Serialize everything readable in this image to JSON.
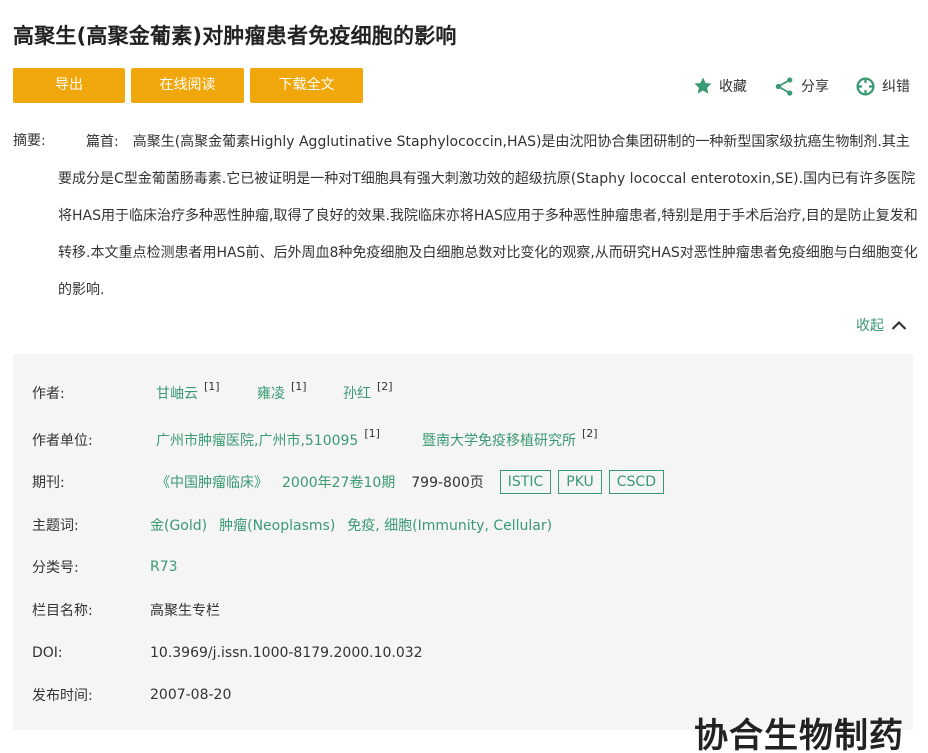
{
  "article": {
    "title": "高聚生(高聚金葡素)对肿瘤患者免疫细胞的影响"
  },
  "toolbar": {
    "export_label": "导出",
    "read_online_label": "在线阅读",
    "download_label": "下载全文",
    "favorite_label": "收藏",
    "share_label": "分享",
    "report_error_label": "纠错"
  },
  "abstract": {
    "label": "摘要:",
    "prefix": "篇首:",
    "text": "高聚生(高聚金葡素Highly Agglutinative Staphylococcin,HAS)是由沈阳协合集团研制的一种新型国家级抗癌生物制剂.其主要成分是C型金葡菌肠毒素.它已被证明是一种对T细胞具有强大刺激功效的超级抗原(Staphy lococcal enterotoxin,SE).国内已有许多医院将HAS用于临床治疗多种恶性肿瘤,取得了良好的效果.我院临床亦将HAS应用于多种恶性肿瘤患者,特别是用于手术后治疗,目的是防止复发和转移.本文重点检测患者用HAS前、后外周血8种免疫细胞及白细胞总数对比变化的观察,从而研究HAS对恶性肿瘤患者免疫细胞与白细胞变化的影响.",
    "collapse_label": "收起"
  },
  "meta": {
    "authors_label": "作者:",
    "authors": [
      {
        "name": "甘岫云",
        "ref": "[1]"
      },
      {
        "name": "雍凌",
        "ref": "[1]"
      },
      {
        "name": "孙红",
        "ref": "[2]"
      }
    ],
    "affiliations_label": "作者单位:",
    "affiliations": [
      {
        "name": "广州市肿瘤医院,广州市,510095",
        "ref": "[1]"
      },
      {
        "name": "暨南大学免疫移植研究所",
        "ref": "[2]"
      }
    ],
    "journal_label": "期刊:",
    "journal_name": "《中国肿瘤临床》",
    "journal_issue": "2000年27卷10期",
    "journal_pages": "799-800页",
    "journal_badges": [
      "ISTIC",
      "PKU",
      "CSCD"
    ],
    "keywords_label": "主题词:",
    "keywords": [
      "金(Gold)",
      "肿瘤(Neoplasms)",
      "免疫, 细胞(Immunity, Cellular)"
    ],
    "classification_label": "分类号:",
    "classification": "R73",
    "column_label": "栏目名称:",
    "column": "高聚生专栏",
    "doi_label": "DOI:",
    "doi": "10.3969/j.issn.1000-8179.2000.10.032",
    "publish_date_label": "发布时间:",
    "publish_date": "2007-08-20"
  },
  "watermark": "协合生物制药",
  "colors": {
    "accent": "#f0a70b",
    "link": "#3a9a72",
    "panel": "#f5f5f5"
  }
}
